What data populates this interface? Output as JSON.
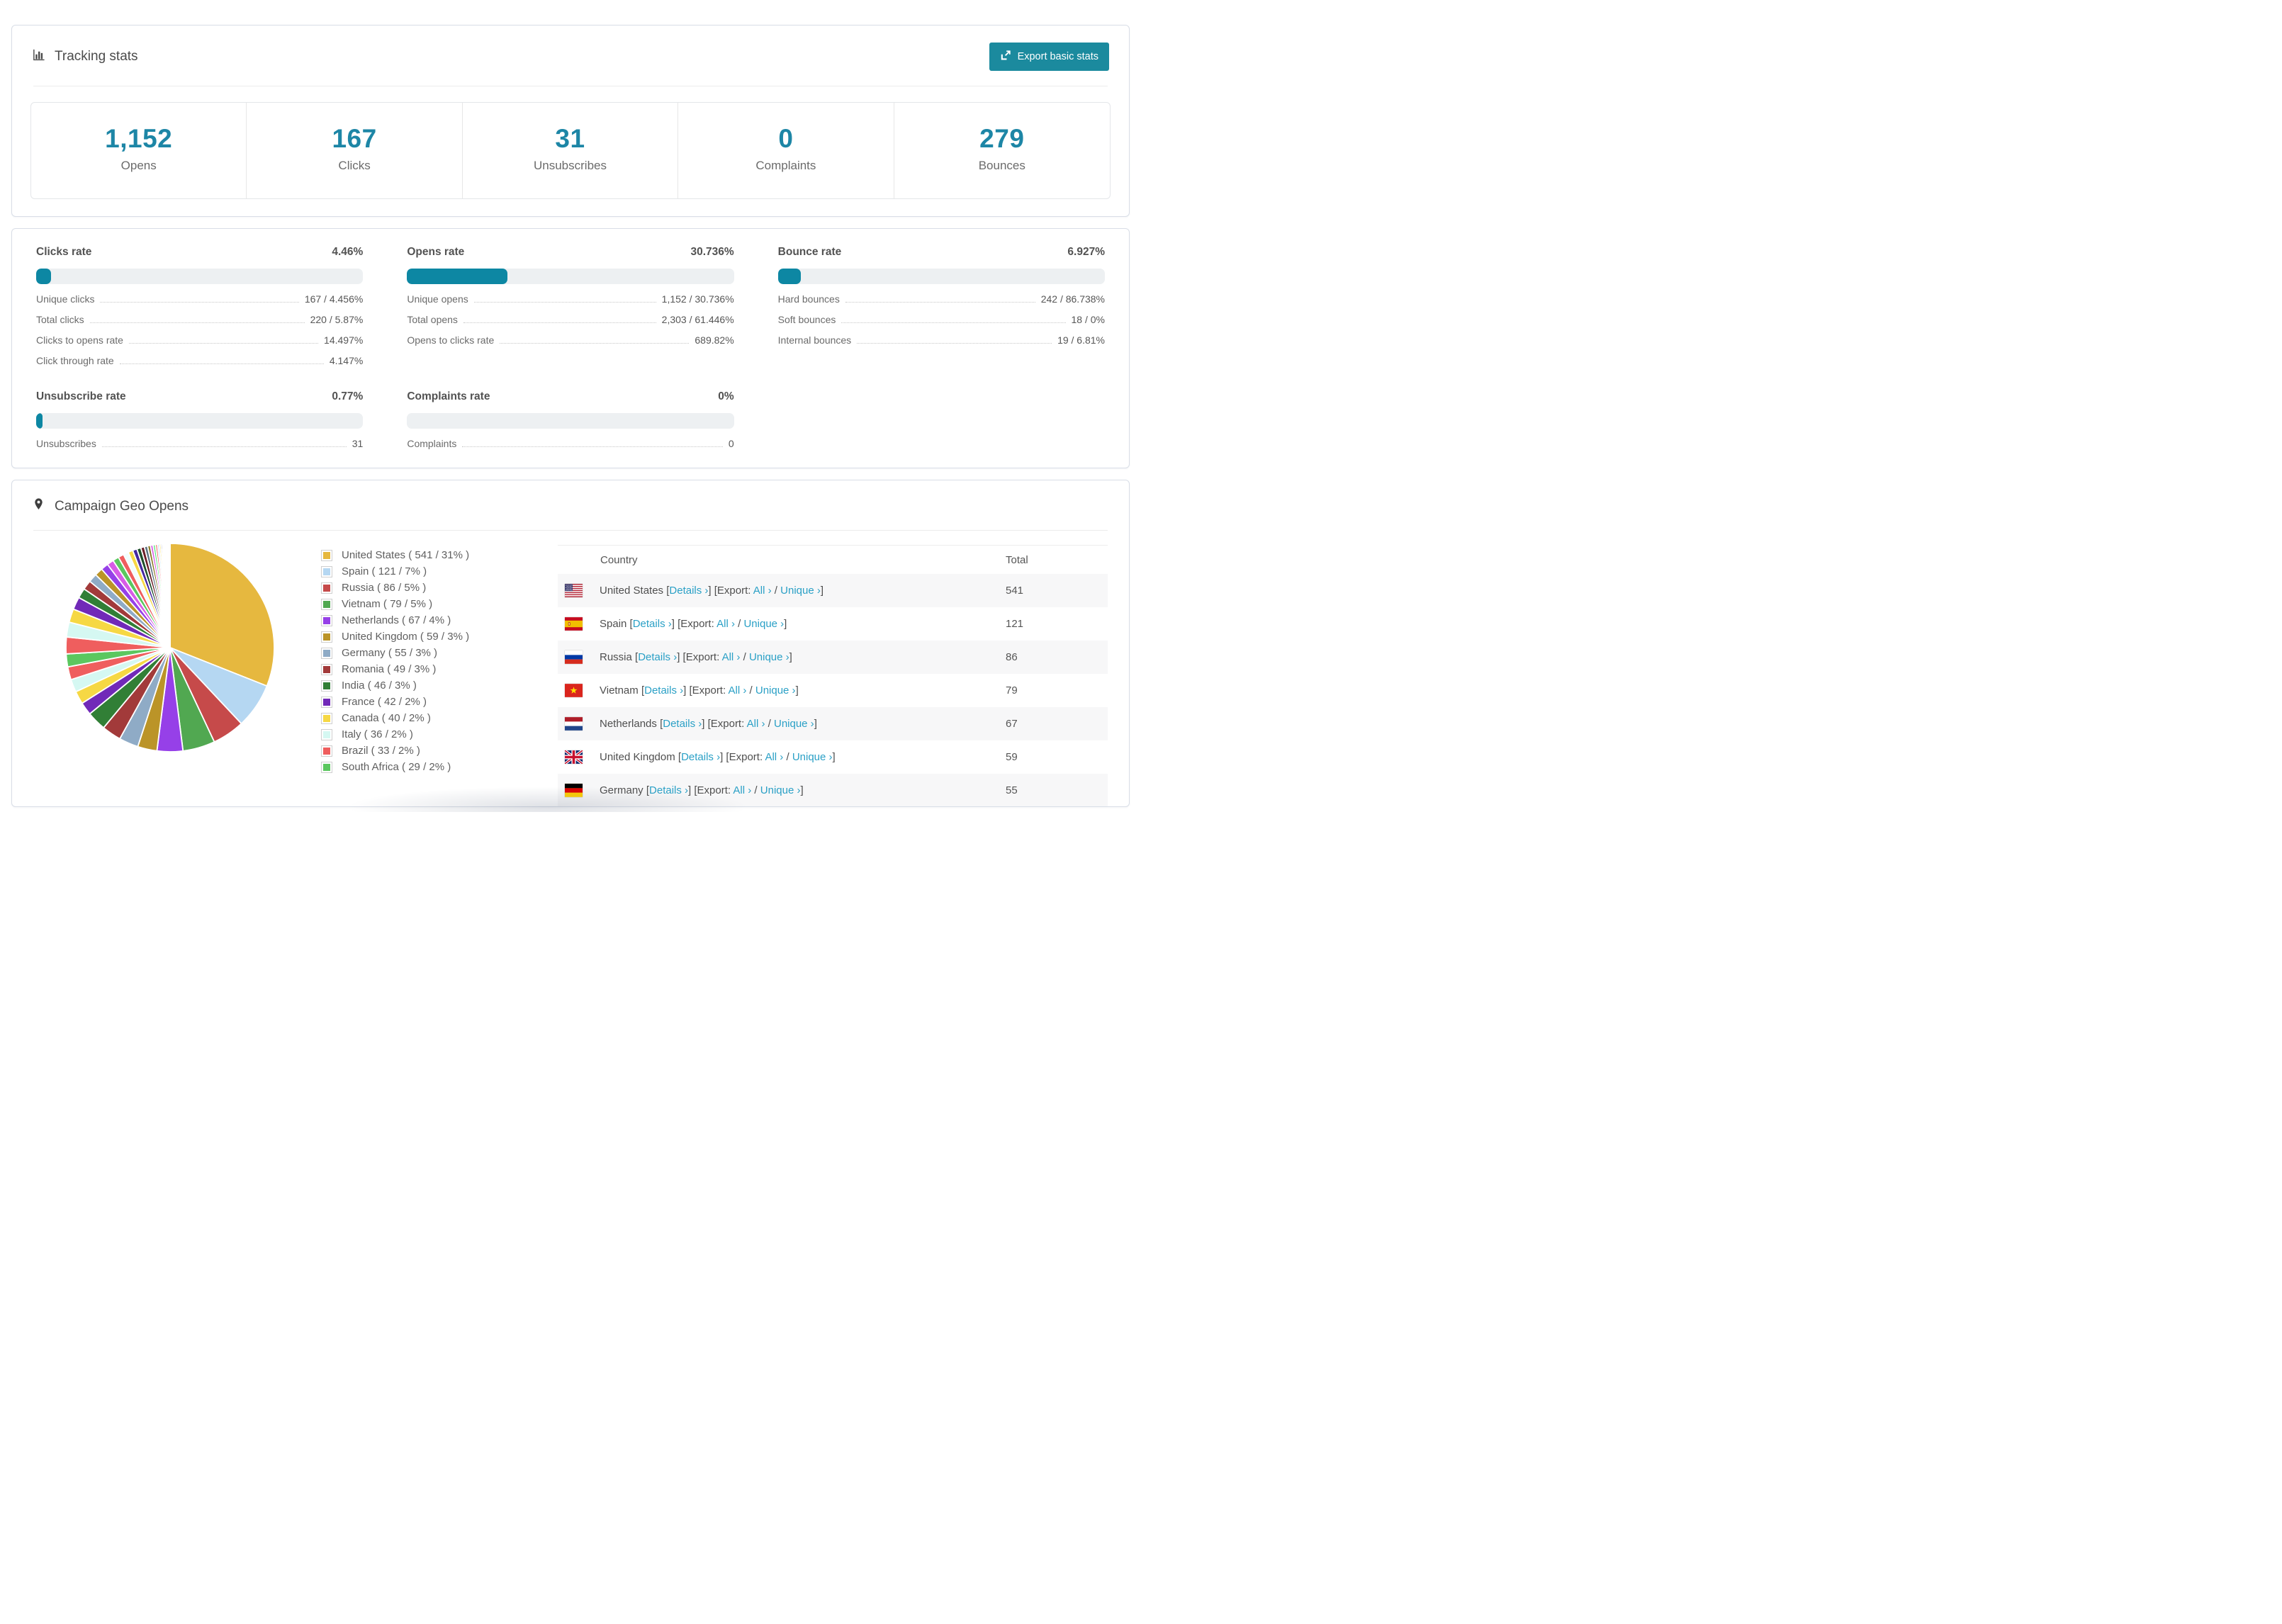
{
  "colors": {
    "accent_teal": "#1d86a6",
    "bar_fill": "#0d87a3",
    "button_bg": "#1b8a9e",
    "link": "#2aa0c6",
    "row_stripe": "#f7f7f8"
  },
  "tracking": {
    "title": "Tracking stats",
    "export_button": "Export basic stats",
    "stats": [
      {
        "value": "1,152",
        "label": "Opens"
      },
      {
        "value": "167",
        "label": "Clicks"
      },
      {
        "value": "31",
        "label": "Unsubscribes"
      },
      {
        "value": "0",
        "label": "Complaints"
      },
      {
        "value": "279",
        "label": "Bounces"
      }
    ]
  },
  "rates": {
    "blocks": [
      {
        "title": "Clicks rate",
        "value": "4.46%",
        "pct": 4.46,
        "rows": [
          {
            "label": "Unique clicks",
            "value": "167 / 4.456%"
          },
          {
            "label": "Total clicks",
            "value": "220 / 5.87%"
          },
          {
            "label": "Clicks to opens rate",
            "value": "14.497%"
          },
          {
            "label": "Click through rate",
            "value": "4.147%"
          }
        ]
      },
      {
        "title": "Opens rate",
        "value": "30.736%",
        "pct": 30.736,
        "rows": [
          {
            "label": "Unique opens",
            "value": "1,152 / 30.736%"
          },
          {
            "label": "Total opens",
            "value": "2,303 / 61.446%"
          },
          {
            "label": "Opens to clicks rate",
            "value": "689.82%"
          }
        ]
      },
      {
        "title": "Bounce rate",
        "value": "6.927%",
        "pct": 6.927,
        "rows": [
          {
            "label": "Hard bounces",
            "value": "242 / 86.738%"
          },
          {
            "label": "Soft bounces",
            "value": "18 / 0%"
          },
          {
            "label": "Internal bounces",
            "value": "19 / 6.81%"
          }
        ]
      },
      {
        "title": "Unsubscribe rate",
        "value": "0.77%",
        "pct": 0.77,
        "rows": [
          {
            "label": "Unsubscribes",
            "value": "31"
          }
        ]
      },
      {
        "title": "Complaints rate",
        "value": "0%",
        "pct": 0,
        "rows": [
          {
            "label": "Complaints",
            "value": "0"
          }
        ]
      }
    ]
  },
  "geo": {
    "title": "Campaign Geo Opens",
    "table": {
      "headers": [
        "Country",
        "Total"
      ],
      "segments": [
        {
          "text": "["
        },
        {
          "link": "Details ›"
        },
        {
          "text": "] [Export: "
        },
        {
          "link": "All ›"
        },
        {
          "text": " / "
        },
        {
          "link": "Unique ›"
        },
        {
          "text": "]"
        }
      ],
      "rows": [
        {
          "country": "United States",
          "flag": "us",
          "total": "541"
        },
        {
          "country": "Spain",
          "flag": "es",
          "total": "121"
        },
        {
          "country": "Russia",
          "flag": "ru",
          "total": "86"
        },
        {
          "country": "Vietnam",
          "flag": "vn",
          "total": "79"
        },
        {
          "country": "Netherlands",
          "flag": "nl",
          "total": "67"
        },
        {
          "country": "United Kingdom",
          "flag": "gb",
          "total": "59"
        },
        {
          "country": "Germany",
          "flag": "de",
          "total": "55"
        }
      ]
    }
  },
  "chart_data": {
    "type": "pie",
    "title": "Campaign Geo Opens",
    "legend_position": "right",
    "start_angle": "top",
    "direction": "clockwise",
    "series": [
      {
        "name": "United States",
        "value": 541,
        "pct": 31,
        "color": "#e6b83f",
        "label": "United States ( 541 / 31% )"
      },
      {
        "name": "Spain",
        "value": 121,
        "pct": 7,
        "color": "#b5d7f2",
        "label": "Spain ( 121 / 7% )"
      },
      {
        "name": "Russia",
        "value": 86,
        "pct": 5,
        "color": "#c64a4a",
        "label": "Russia ( 86 / 5% )"
      },
      {
        "name": "Vietnam",
        "value": 79,
        "pct": 5,
        "color": "#51a851",
        "label": "Vietnam ( 79 / 5% )"
      },
      {
        "name": "Netherlands",
        "value": 67,
        "pct": 4,
        "color": "#9640e8",
        "label": "Netherlands ( 67 / 4% )"
      },
      {
        "name": "United Kingdom",
        "value": 59,
        "pct": 3,
        "color": "#bb9428",
        "label": "United Kingdom ( 59 / 3% )"
      },
      {
        "name": "Germany",
        "value": 55,
        "pct": 3,
        "color": "#8fabc6",
        "label": "Germany ( 55 / 3% )"
      },
      {
        "name": "Romania",
        "value": 49,
        "pct": 3,
        "color": "#a23a3a",
        "label": "Romania ( 49 / 3% )"
      },
      {
        "name": "India",
        "value": 46,
        "pct": 3,
        "color": "#317f36",
        "label": "India ( 46 / 3% )"
      },
      {
        "name": "France",
        "value": 42,
        "pct": 2,
        "color": "#7129b8",
        "label": "France ( 42 / 2% )"
      },
      {
        "name": "Canada",
        "value": 40,
        "pct": 2,
        "color": "#f6d844",
        "label": "Canada ( 40 / 2% )"
      },
      {
        "name": "Italy",
        "value": 36,
        "pct": 2,
        "color": "#d5f8f2",
        "label": "Italy ( 36 / 2% )"
      },
      {
        "name": "Brazil",
        "value": 33,
        "pct": 2,
        "color": "#ef5e5e",
        "label": "Brazil ( 33 / 2% )"
      },
      {
        "name": "South Africa",
        "value": 29,
        "pct": 2,
        "color": "#5bc75f",
        "label": "South Africa ( 29 / 2% )"
      }
    ],
    "others_unlabeled": {
      "note": "long tail of small unlabeled slices, estimated pct values",
      "values": [
        2.6,
        2.3,
        2.1,
        1.95,
        1.55,
        1.45,
        1.35,
        1.25,
        1.15,
        1.05,
        0.95,
        0.88,
        0.8,
        0.74,
        0.68,
        0.62,
        0.56,
        0.5,
        0.45,
        0.4,
        0.36,
        0.32,
        0.28,
        0.25,
        0.22,
        0.19,
        0.17,
        0.15,
        0.13,
        0.11,
        0.09,
        0.08,
        0.07,
        0.06,
        0.05,
        0.04,
        0.03,
        0.03
      ],
      "colors": [
        "#ef5e5e",
        "#d5f8f2",
        "#f6d844",
        "#7129b8",
        "#317f36",
        "#a23a3a",
        "#8fabc6",
        "#bb9428",
        "#9640e8",
        "#d75ce6",
        "#5bc75f",
        "#ef5e5e",
        "#effffd",
        "#f6d844",
        "#4527a0",
        "#1d4f2b",
        "#6b1f28",
        "#5a7482",
        "#8a7a24",
        "#d75ce6",
        "#5ce87f",
        "#ef5e5e",
        "#b5d7f2",
        "#f6d844",
        "#23306e",
        "#123f46",
        "#6b1f28",
        "#317f36",
        "#d75ce6",
        "#5ce87f",
        "#ef5e5e",
        "#b5d7f2",
        "#e6b83f",
        "#c64a4a",
        "#51a851",
        "#9640e8",
        "#bb9428",
        "#d75ce6"
      ]
    }
  }
}
